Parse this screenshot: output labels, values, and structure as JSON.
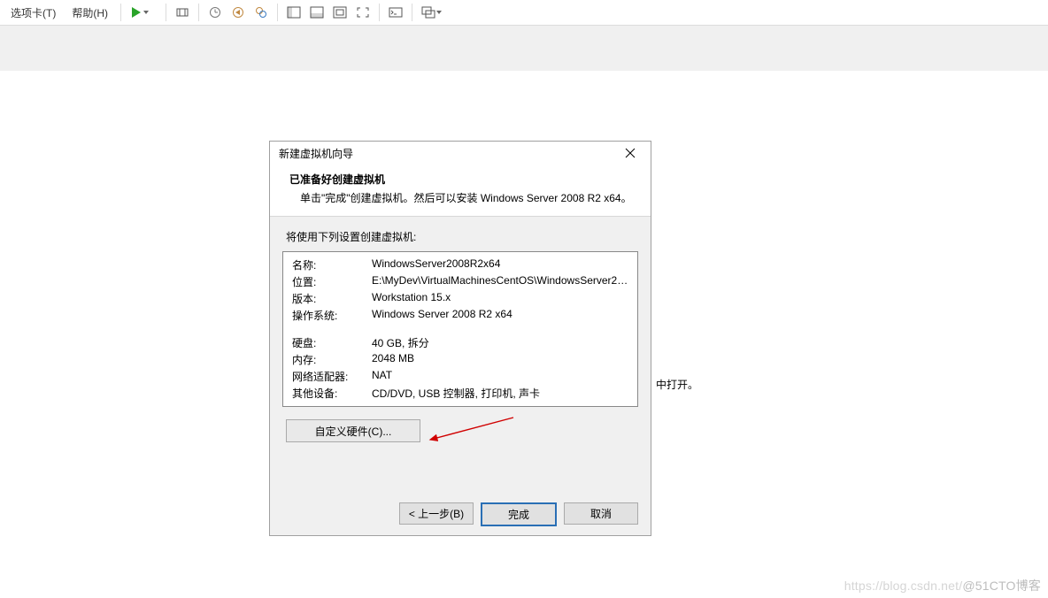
{
  "menu": {
    "tabs": "选项卡(T)",
    "help": "帮助(H)"
  },
  "dialog": {
    "title": "新建虚拟机向导",
    "heading": "已准备好创建虚拟机",
    "subheading": "单击\"完成\"创建虚拟机。然后可以安装 Windows Server 2008 R2 x64。",
    "settings_caption": "将使用下列设置创建虚拟机:",
    "rows": {
      "name_l": "名称:",
      "name_v": "WindowsServer2008R2x64",
      "loc_l": "位置:",
      "loc_v": "E:\\MyDev\\VirtualMachinesCentOS\\WindowsServer2008R...",
      "ver_l": "版本:",
      "ver_v": "Workstation 15.x",
      "os_l": "操作系统:",
      "os_v": "Windows Server 2008 R2 x64",
      "disk_l": "硬盘:",
      "disk_v": "40 GB, 拆分",
      "mem_l": "内存:",
      "mem_v": "2048 MB",
      "net_l": "网络适配器:",
      "net_v": "NAT",
      "oth_l": "其他设备:",
      "oth_v": "CD/DVD, USB 控制器, 打印机, 声卡"
    },
    "customize": "自定义硬件(C)...",
    "back": "< 上一步(B)",
    "finish": "完成",
    "cancel": "取消"
  },
  "stray_text": "中打开。",
  "watermark": {
    "left": "https://blog.csdn.net/",
    "right": "@51CTO博客"
  }
}
